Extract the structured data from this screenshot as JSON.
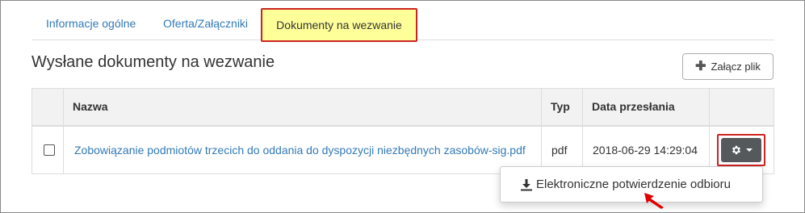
{
  "tabs": [
    {
      "label": "Informacje ogólne"
    },
    {
      "label": "Oferta/Załączniki"
    },
    {
      "label": "Dokumenty na wezwanie"
    }
  ],
  "section": {
    "title": "Wysłane dokumenty na wezwanie",
    "attach_button_label": "Załącz plik",
    "attach_icon": "plus-icon"
  },
  "table": {
    "columns": [
      "",
      "Nazwa",
      "Typ",
      "Data przesłania",
      ""
    ],
    "rows": [
      {
        "checked": false,
        "name": "Zobowiązanie podmiotów trzecich do oddania do dyspozycji niezbędnych zasobów-sig.pdf",
        "type": "pdf",
        "date": "2018-06-29 14:29:04",
        "actions_icon": "gear-icon"
      }
    ]
  },
  "dropdown": {
    "items": [
      {
        "label": "Elektroniczne potwierdzenie odbioru",
        "icon": "download-icon"
      }
    ]
  },
  "colors": {
    "link": "#337ab7",
    "active_tab_bg": "#ffff99",
    "highlight_border": "#cc2222",
    "gear_button_bg": "#55595c"
  }
}
